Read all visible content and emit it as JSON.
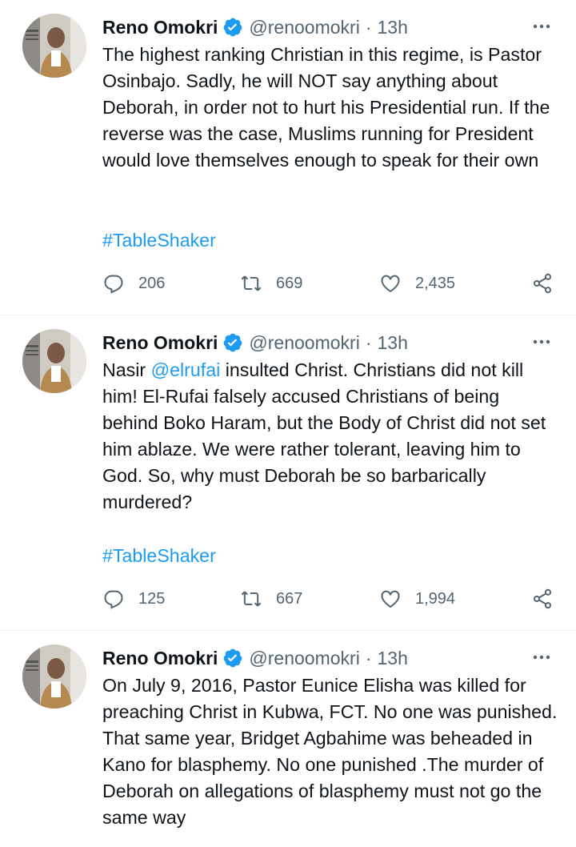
{
  "tweets": [
    {
      "name": "Reno Omokri",
      "handle": "@renoomokri",
      "separator": "·",
      "time": "13h",
      "text_parts": [
        "The highest ranking Christian in this regime, is Pastor Osinbajo. Sadly, he will NOT say anything about Deborah, in order not to hurt his Presidential run. If the reverse was the case, Muslims running for President would love themselves enough to speak for their own"
      ],
      "hashtag": "#TableShaker",
      "replies": "206",
      "retweets": "669",
      "likes": "2,435"
    },
    {
      "name": "Reno Omokri",
      "handle": "@renoomokri",
      "separator": "·",
      "time": "13h",
      "text_parts": [
        "Nasir ",
        "@elrufai",
        " insulted Christ. Christians did not kill him! El-Rufai falsely accused Christians of being behind Boko Haram, but the Body of Christ did not set him ablaze. We were rather tolerant, leaving him to God. So, why must Deborah be so barbarically murdered?"
      ],
      "hashtag": "#TableShaker",
      "replies": "125",
      "retweets": "667",
      "likes": "1,994"
    },
    {
      "name": "Reno Omokri",
      "handle": "@renoomokri",
      "separator": "·",
      "time": "13h",
      "text_parts": [
        "On July 9, 2016, Pastor Eunice Elisha was killed for preaching Christ in Kubwa, FCT. No one was punished. That same year, Bridget Agbahime was beheaded in Kano for blasphemy. No one punished .The murder of Deborah on allegations of blasphemy must not go the same way"
      ]
    }
  ],
  "colors": {
    "accent": "#1d9bf0",
    "muted": "#536471",
    "text": "#0f1419"
  },
  "icons": [
    "verified-badge-icon",
    "more-options-icon",
    "reply-icon",
    "retweet-icon",
    "like-icon",
    "share-icon"
  ]
}
